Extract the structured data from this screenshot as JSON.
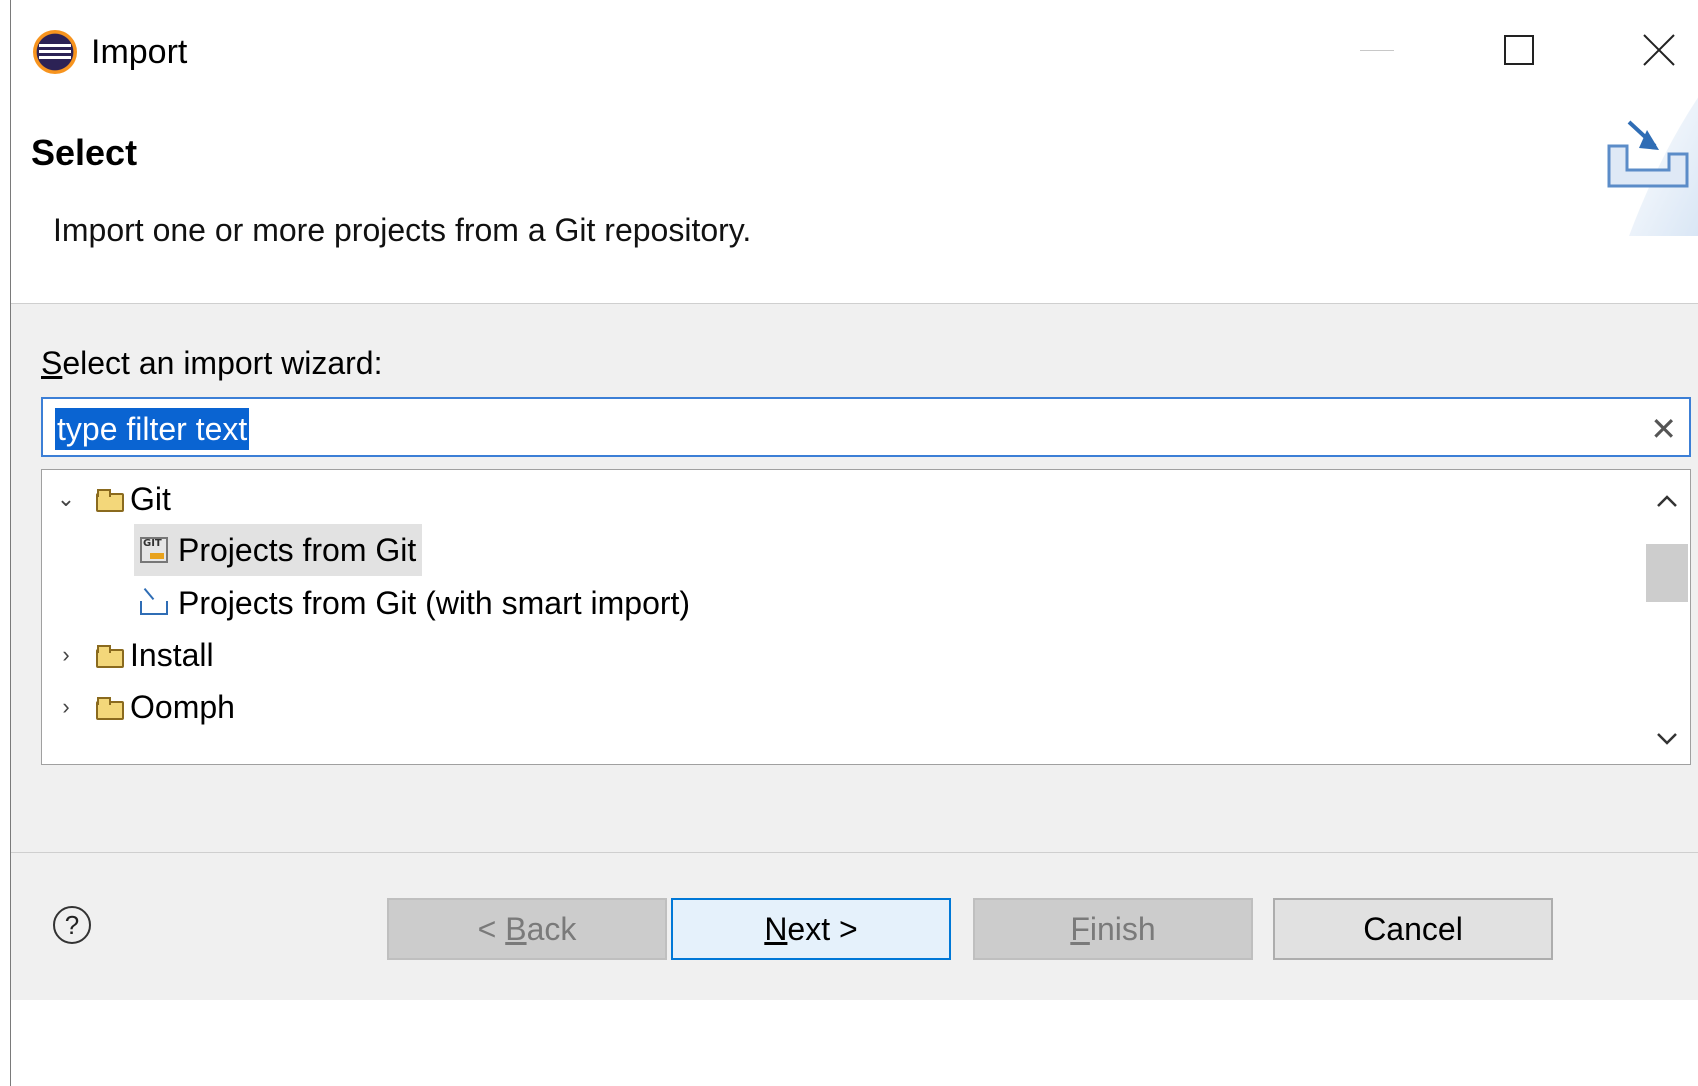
{
  "window": {
    "title": "Import",
    "controls": {
      "minimize": "minimize",
      "maximize": "maximize",
      "close": "close"
    }
  },
  "header": {
    "title": "Select",
    "description": "Import one or more projects from a Git repository.",
    "icon": "import-wizard-banner-icon"
  },
  "content": {
    "label_mnemonic": "S",
    "label_rest": "elect an import wizard:",
    "filter": {
      "value": "type filter text",
      "clear_glyph": "✕"
    },
    "tree": {
      "items": [
        {
          "label": "Git",
          "expanded": true,
          "icon": "folder-icon"
        },
        {
          "label": "Projects from Git",
          "selected": true,
          "icon": "git-import-icon"
        },
        {
          "label": "Projects from Git (with smart import)",
          "icon": "smart-import-icon"
        },
        {
          "label": "Install",
          "expanded": false,
          "icon": "folder-icon"
        },
        {
          "label": "Oomph",
          "expanded": false,
          "icon": "folder-icon"
        }
      ]
    }
  },
  "footer": {
    "help": "?",
    "back": {
      "prefix": "< ",
      "mnemonic": "B",
      "rest": "ack",
      "enabled": false
    },
    "next": {
      "mnemonic": "N",
      "rest": "ext >",
      "enabled": true
    },
    "finish": {
      "mnemonic": "F",
      "rest": "inish",
      "enabled": false
    },
    "cancel": {
      "label": "Cancel",
      "enabled": true
    }
  },
  "colors": {
    "selection": "#0a64d2",
    "focus_border": "#3c7fd6",
    "primary_button_border": "#0078d7",
    "dialog_background": "#f0f0f0"
  }
}
